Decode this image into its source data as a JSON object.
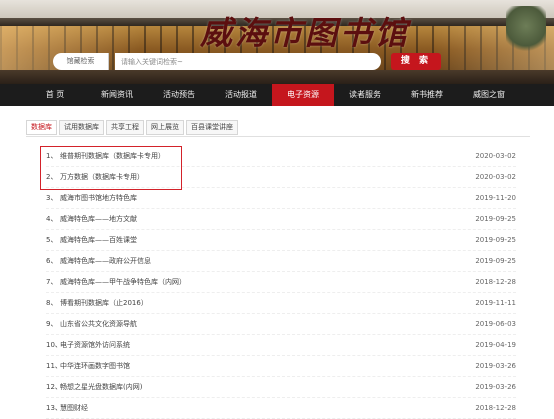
{
  "title": "威海市图书馆",
  "search": {
    "scope_label": "馆藏检索",
    "placeholder": "请输入关键词检索~",
    "button_label": "搜 索"
  },
  "nav": [
    {
      "label": "首  页",
      "active": false
    },
    {
      "label": "新闻资讯",
      "active": false
    },
    {
      "label": "活动预告",
      "active": false
    },
    {
      "label": "活动报道",
      "active": false
    },
    {
      "label": "电子资源",
      "active": true
    },
    {
      "label": "读者服务",
      "active": false
    },
    {
      "label": "新书推荐",
      "active": false
    },
    {
      "label": "威图之窗",
      "active": false
    }
  ],
  "tabs": [
    {
      "label": "数据库",
      "active": true
    },
    {
      "label": "试用数据库",
      "active": false
    },
    {
      "label": "共享工程",
      "active": false
    },
    {
      "label": "网上展览",
      "active": false
    },
    {
      "label": "百县课堂讲座",
      "active": false
    }
  ],
  "items": [
    {
      "num": "1、",
      "title": "维普期刊数据库（数据库卡专用）",
      "date": "2020-03-02"
    },
    {
      "num": "2、",
      "title": "万方数据（数据库卡专用）",
      "date": "2020-03-02"
    },
    {
      "num": "3、",
      "title": "威海市图书馆地方特色库",
      "date": "2019-11-20"
    },
    {
      "num": "4、",
      "title": "威海特色库——地方文献",
      "date": "2019-09-25"
    },
    {
      "num": "5、",
      "title": "威海特色库——百姓课堂",
      "date": "2019-09-25"
    },
    {
      "num": "6、",
      "title": "威海特色库——政府公开信息",
      "date": "2019-09-25"
    },
    {
      "num": "7、",
      "title": "威海特色库——甲午战争特色库（内网）",
      "date": "2018-12-28"
    },
    {
      "num": "8、",
      "title": "博看期刊数据库（止2016）",
      "date": "2019-11-11"
    },
    {
      "num": "9、",
      "title": "山东省公共文化资源导航",
      "date": "2019-06-03"
    },
    {
      "num": "10、",
      "title": "电子资源馆外访问系统",
      "date": "2019-04-19"
    },
    {
      "num": "11、",
      "title": "中华连环画数字图书馆",
      "date": "2019-03-26"
    },
    {
      "num": "12、",
      "title": "畅想之星光盘数据库(内网)",
      "date": "2019-03-26"
    },
    {
      "num": "13、",
      "title": "慧图财经",
      "date": "2018-12-28"
    }
  ],
  "colors": {
    "accent": "#c5161d",
    "nav_bg": "#1c1c1c",
    "highlight": "#d3222a"
  }
}
